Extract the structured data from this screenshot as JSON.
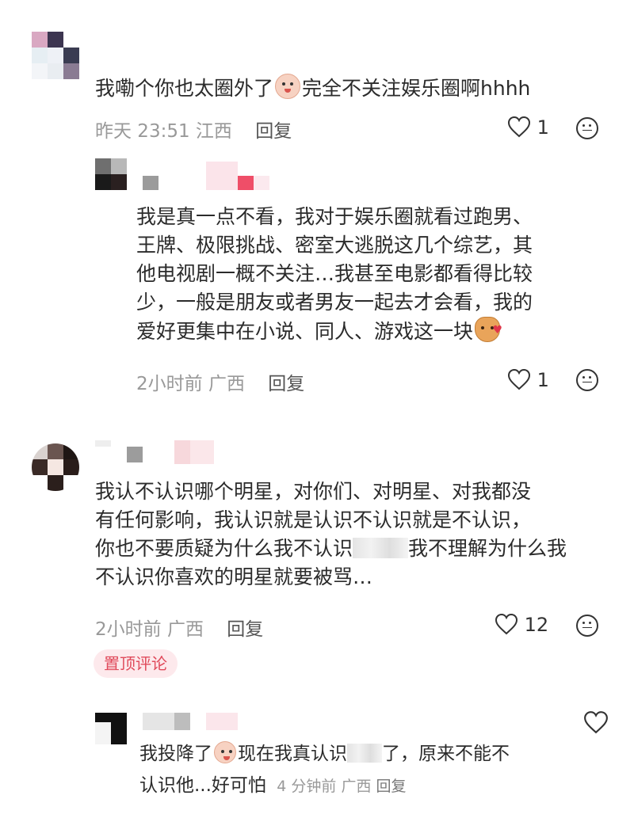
{
  "comments": [
    {
      "text_before_emoji": "我嘞个你也太圈外了",
      "emoji": "baby-crying-emoji",
      "text_after_emoji": "完全不关注娱乐圈啊hhhh",
      "time": "昨天 23:51",
      "location": "江西",
      "reply_label": "回复",
      "likes": "1"
    },
    {
      "text_lines": [
        "我是真一点不看，我对于娱乐圈就看过跑男、",
        "王牌、极限挑战、密室大逃脱这几个综艺，其",
        "他电视剧一概不关注…我甚至电影都看得比较",
        "少，一般是朋友或者男友一起去才会看，我的"
      ],
      "last_line": "爱好更集中在小说、同人、游戏这一块",
      "emoji": "cat-heart-emoji",
      "time": "2小时前",
      "location": "广西",
      "reply_label": "回复",
      "likes": "1"
    },
    {
      "text_lines": [
        "我认不认识哪个明星，对你们、对明星、对我都没",
        "有任何影响，我认识就是认识不认识就是不认识，"
      ],
      "line3_before": "你也不要质疑为什么我不认识",
      "line3_after": "我不理解为什么我",
      "line4": "不认识你喜欢的明星就要被骂…",
      "time": "2小时前",
      "location": "广西",
      "reply_label": "回复",
      "likes": "12",
      "pinned_label": "置顶评论"
    },
    {
      "line1_before": "我投降了",
      "emoji": "baby-smile-emoji",
      "line1_mid": "现在我真认识",
      "line1_after": "了，原来不能不",
      "line2": "认识他...好可怕",
      "time": "4 分钟前",
      "location": "广西",
      "reply_label": "回复"
    }
  ]
}
